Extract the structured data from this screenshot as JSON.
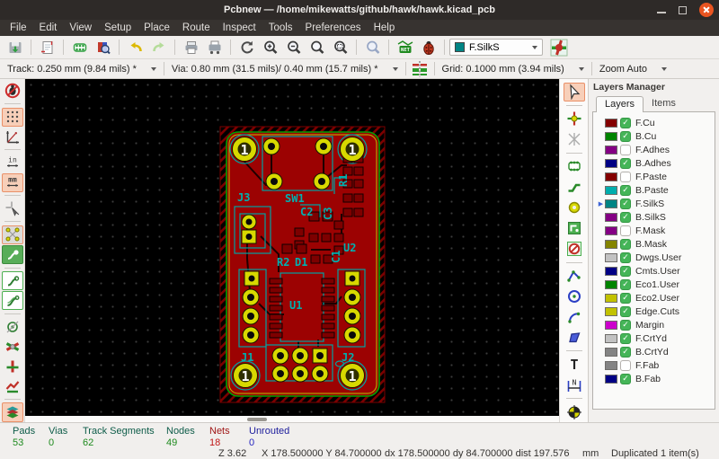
{
  "window": {
    "title": "Pcbnew — /home/mikewatts/github/hawk/hawk.kicad_pcb"
  },
  "menu": {
    "items": [
      "File",
      "Edit",
      "View",
      "Setup",
      "Place",
      "Route",
      "Inspect",
      "Tools",
      "Preferences",
      "Help"
    ]
  },
  "toolbar": {
    "layer_selector_value": "F.SilkS",
    "net_label": "NET"
  },
  "toolbar2": {
    "track": "Track: 0.250 mm (9.84 mils) *",
    "via": "Via: 0.80 mm (31.5 mils)/ 0.40 mm (15.7 mils) *",
    "grid": "Grid: 0.1000 mm (3.94 mils)",
    "zoom": "Zoom Auto"
  },
  "icons": {
    "units_in": "in",
    "units_mm": "mm",
    "text_tool": "T",
    "dim_n": "N",
    "check_glyph": "✓",
    "current_layer_arrow": "▶"
  },
  "layers_manager": {
    "title": "Layers Manager",
    "tabs": [
      "Layers",
      "Items"
    ],
    "active_tab": "Layers",
    "layers": [
      {
        "name": "F.Cu",
        "color": "#840000",
        "visible": true,
        "current": false
      },
      {
        "name": "B.Cu",
        "color": "#008400",
        "visible": true,
        "current": false
      },
      {
        "name": "F.Adhes",
        "color": "#840084",
        "visible": false,
        "current": false
      },
      {
        "name": "B.Adhes",
        "color": "#000084",
        "visible": true,
        "current": false
      },
      {
        "name": "F.Paste",
        "color": "#840000",
        "visible": false,
        "current": false
      },
      {
        "name": "B.Paste",
        "color": "#00adad",
        "visible": true,
        "current": false
      },
      {
        "name": "F.SilkS",
        "color": "#008484",
        "visible": true,
        "current": true
      },
      {
        "name": "B.SilkS",
        "color": "#840084",
        "visible": true,
        "current": false
      },
      {
        "name": "F.Mask",
        "color": "#840084",
        "visible": false,
        "current": false
      },
      {
        "name": "B.Mask",
        "color": "#848400",
        "visible": true,
        "current": false
      },
      {
        "name": "Dwgs.User",
        "color": "#c2c2c2",
        "visible": true,
        "current": false
      },
      {
        "name": "Cmts.User",
        "color": "#000084",
        "visible": true,
        "current": false
      },
      {
        "name": "Eco1.User",
        "color": "#008400",
        "visible": true,
        "current": false
      },
      {
        "name": "Eco2.User",
        "color": "#c2c200",
        "visible": true,
        "current": false
      },
      {
        "name": "Edge.Cuts",
        "color": "#c2c200",
        "visible": true,
        "current": false
      },
      {
        "name": "Margin",
        "color": "#cc00cc",
        "visible": true,
        "current": false
      },
      {
        "name": "F.CrtYd",
        "color": "#c2c2c2",
        "visible": true,
        "current": false
      },
      {
        "name": "B.CrtYd",
        "color": "#848484",
        "visible": true,
        "current": false
      },
      {
        "name": "F.Fab",
        "color": "#848484",
        "visible": false,
        "current": false
      },
      {
        "name": "B.Fab",
        "color": "#000084",
        "visible": true,
        "current": false
      }
    ]
  },
  "pcb": {
    "pad_number": "1",
    "labels": [
      "J3",
      "SW1",
      "C2",
      "C3",
      "R1",
      "R2",
      "D1",
      "U2",
      "C1",
      "U1",
      "J1",
      "J2"
    ]
  },
  "status": {
    "counts": [
      {
        "label": "Pads",
        "value": "53",
        "label_color": "#0e5c49",
        "value_color": "#1e8a1e"
      },
      {
        "label": "Vias",
        "value": "0",
        "label_color": "#0e5c49",
        "value_color": "#1e8a1e"
      },
      {
        "label": "Track Segments",
        "value": "62",
        "label_color": "#0e5c49",
        "value_color": "#1e8a1e"
      },
      {
        "label": "Nodes",
        "value": "49",
        "label_color": "#0e5c49",
        "value_color": "#1e8a1e"
      },
      {
        "label": "Nets",
        "value": "18",
        "label_color": "#a01616",
        "value_color": "#c01616"
      },
      {
        "label": "Unrouted",
        "value": "0",
        "label_color": "#1c1c9c",
        "value_color": "#2424c0"
      }
    ],
    "zoom_level": "Z 3.62",
    "cursor_pos": "X 178.500000 Y 84.700000",
    "relative_pos": "dx 178.500000 dy 84.700000 dist 197.576",
    "units": "mm",
    "message": "Duplicated 1 item(s)"
  }
}
